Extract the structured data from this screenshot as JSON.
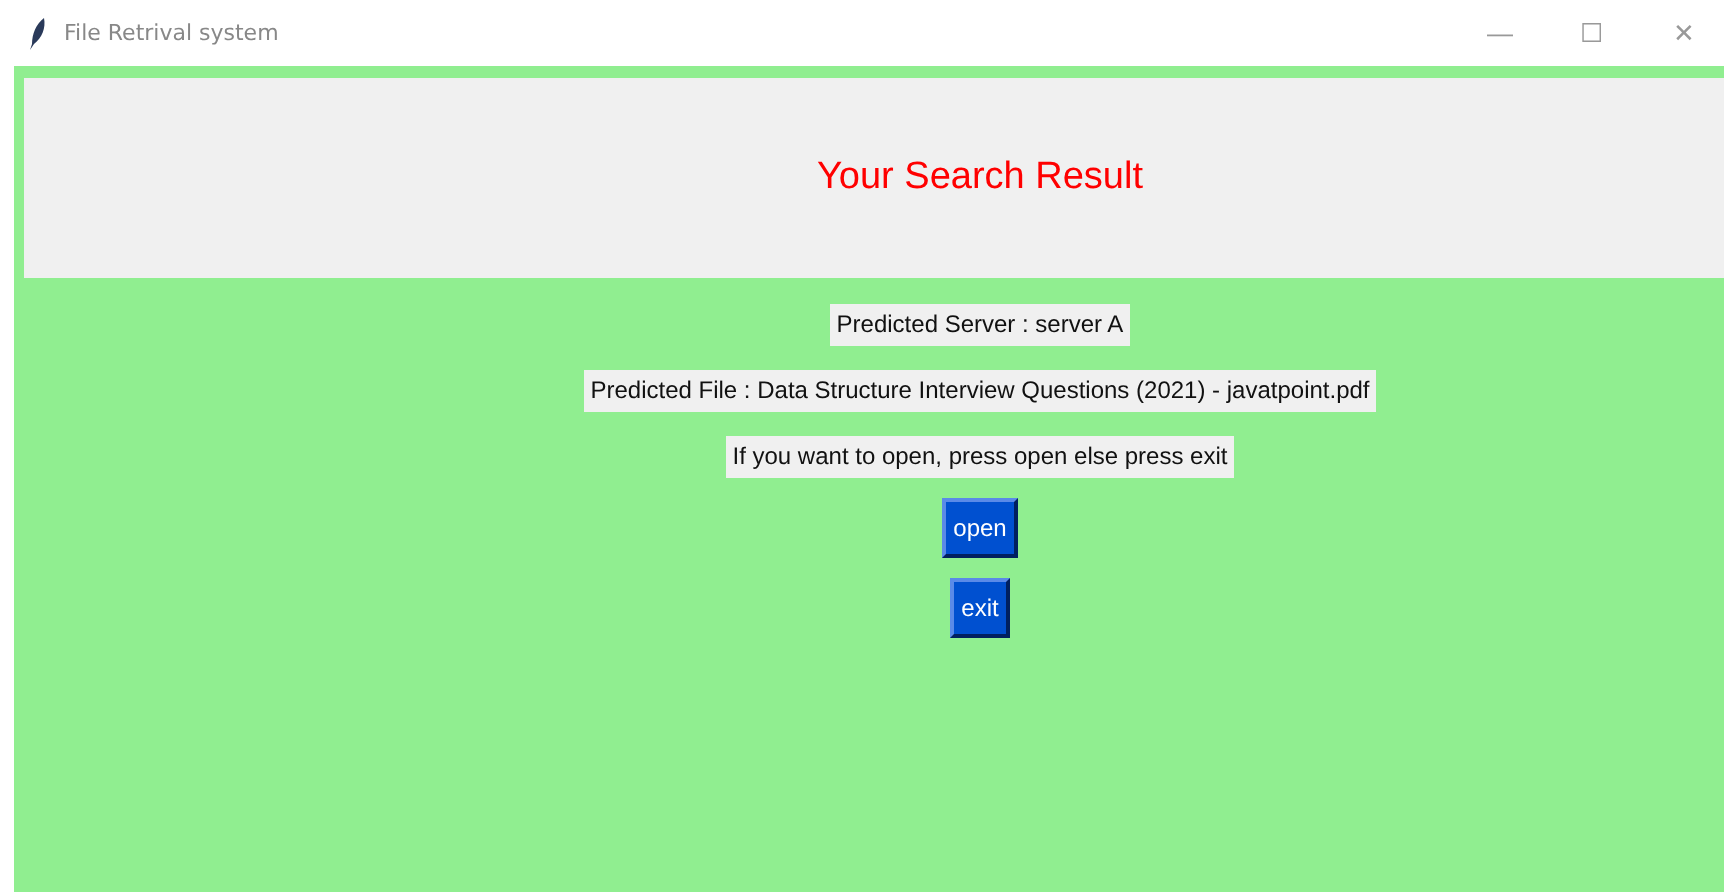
{
  "window": {
    "title": "File Retrival system",
    "controls": [
      "—",
      "☐",
      "✕"
    ]
  },
  "header": {
    "title": "Your Search Result"
  },
  "labels": [
    "Predicted Server : server A",
    "Predicted File : Data Structure Interview Questions (2021) - javatpoint.pdf",
    "If you want to open, press open else press exit "
  ],
  "buttons": [
    "open",
    "exit"
  ]
}
